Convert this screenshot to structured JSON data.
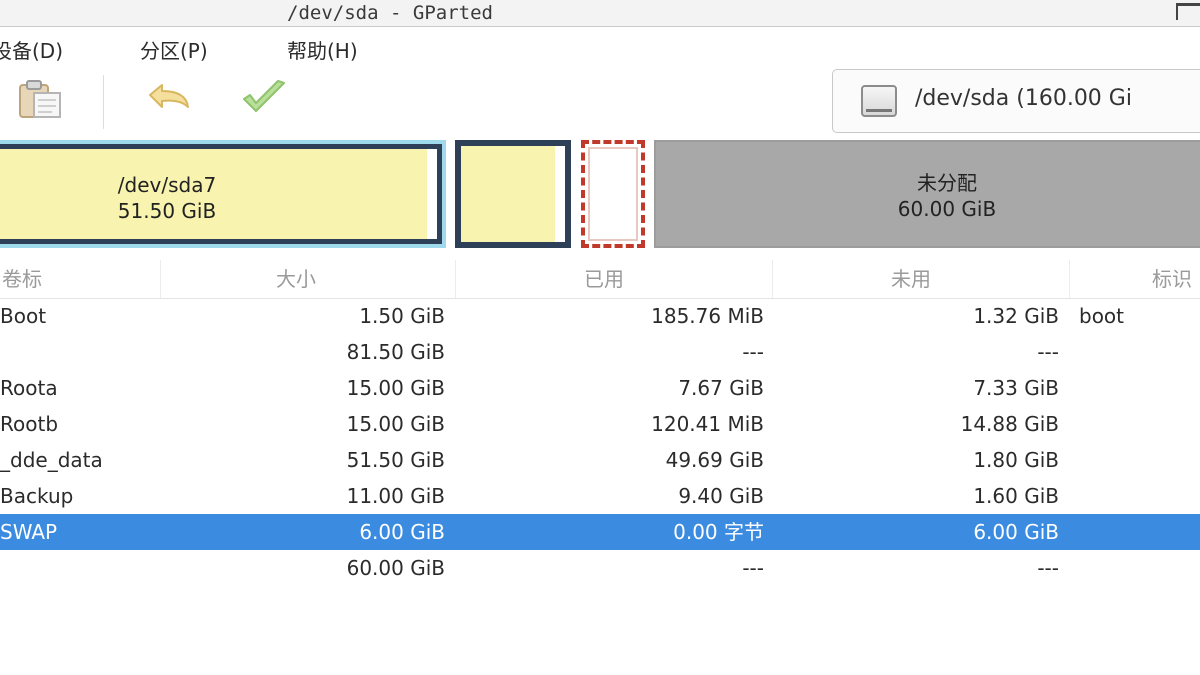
{
  "window": {
    "title": "/dev/sda - GParted"
  },
  "menubar": {
    "items": [
      {
        "label": "设备(D)"
      },
      {
        "label": "分区(P)"
      },
      {
        "label": "帮助(H)"
      }
    ]
  },
  "toolbar": {
    "buttons": [
      {
        "icon": "paste-icon"
      },
      {
        "icon": "undo-icon"
      },
      {
        "icon": "apply-icon"
      }
    ],
    "device_selector": {
      "icon": "disk-icon",
      "value": "/dev/sda (160.00 Gi"
    }
  },
  "graph": {
    "segments": [
      {
        "name": "/dev/sda7",
        "size": "51.50 GiB",
        "fill_color": "#f8f4b0",
        "border_color": "#2d4058"
      },
      {
        "name": "",
        "size": "",
        "fill_color": "#f8f4b0",
        "border_color": "#2d4058"
      },
      {
        "name": "",
        "size": "",
        "fill_color": "#ffffff",
        "border_color": "#c0392b"
      },
      {
        "name": "未分配",
        "size": "60.00 GiB",
        "fill_color": "#a8a8a8",
        "border_color": "#9c9c9c"
      }
    ]
  },
  "table": {
    "columns": [
      "卷标",
      "大小",
      "已用",
      "未用",
      "标识"
    ],
    "rows": [
      {
        "label": "Boot",
        "size": "1.50 GiB",
        "used": "185.76 MiB",
        "unused": "1.32 GiB",
        "flags": "boot",
        "selected": false
      },
      {
        "label": "",
        "size": "81.50 GiB",
        "used": "---",
        "unused": "---",
        "flags": "",
        "selected": false
      },
      {
        "label": "Roota",
        "size": "15.00 GiB",
        "used": "7.67 GiB",
        "unused": "7.33 GiB",
        "flags": "",
        "selected": false
      },
      {
        "label": "Rootb",
        "size": "15.00 GiB",
        "used": "120.41 MiB",
        "unused": "14.88 GiB",
        "flags": "",
        "selected": false
      },
      {
        "label": "_dde_data",
        "size": "51.50 GiB",
        "used": "49.69 GiB",
        "unused": "1.80 GiB",
        "flags": "",
        "selected": false
      },
      {
        "label": "Backup",
        "size": "11.00 GiB",
        "used": "9.40 GiB",
        "unused": "1.60 GiB",
        "flags": "",
        "selected": false
      },
      {
        "label": "SWAP",
        "size": "6.00 GiB",
        "used": "0.00 字节",
        "unused": "6.00 GiB",
        "flags": "",
        "selected": true
      },
      {
        "label": "",
        "size": "60.00 GiB",
        "used": "---",
        "unused": "---",
        "flags": "",
        "selected": false
      }
    ]
  },
  "colors": {
    "selection": "#3b8be0",
    "partition_fill": "#f8f4b0",
    "unallocated": "#a8a8a8",
    "selected_outline": "#9fd9ec"
  }
}
